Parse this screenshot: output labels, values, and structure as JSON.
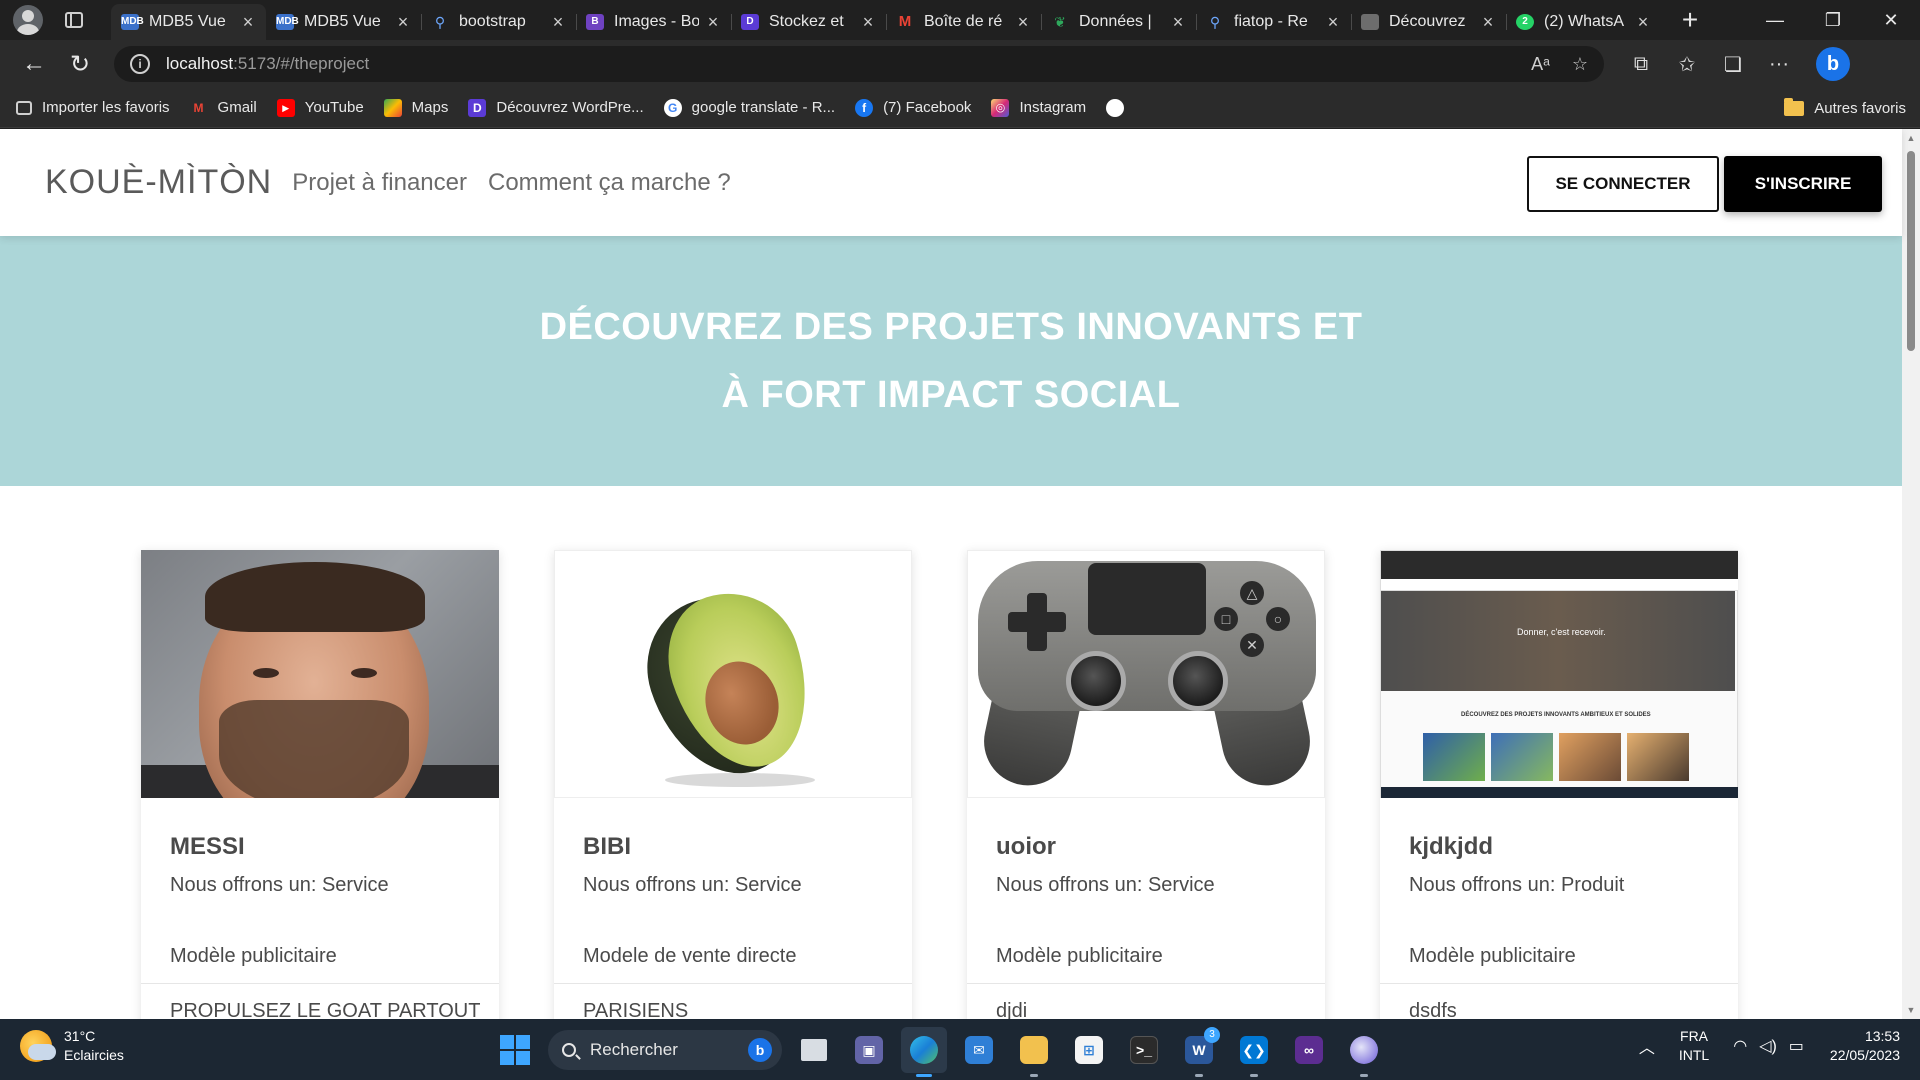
{
  "browser": {
    "tabs": [
      {
        "title": "MDB5 Vue",
        "favicon": "MDB",
        "color": "#3b71ca",
        "active": true
      },
      {
        "title": "MDB5 Vue",
        "favicon": "MDB",
        "color": "#3b71ca",
        "active": false
      },
      {
        "title": "bootstrap",
        "favicon": "search-icon",
        "color": "#3b71ca",
        "active": false
      },
      {
        "title": "Images - Bo",
        "favicon": "B",
        "color": "#6f42c1",
        "active": false
      },
      {
        "title": "Stockez et",
        "favicon": "D",
        "color": "#5b3bd6",
        "active": false
      },
      {
        "title": "Boîte de ré",
        "favicon": "M",
        "color": "#ea4335",
        "active": false
      },
      {
        "title": "Données |",
        "favicon": "leaf",
        "color": "#1e6b3b",
        "active": false
      },
      {
        "title": "fiatop - Re",
        "favicon": "search-icon",
        "color": "#3b71ca",
        "active": false
      },
      {
        "title": "Découvrez",
        "favicon": "page",
        "color": "#6d6d6d",
        "active": false
      },
      {
        "title": "(2) WhatsA",
        "favicon": "2",
        "color": "#25d366",
        "active": false
      }
    ],
    "url_host": "localhost",
    "url_path": ":5173/#/theproject",
    "bookmarks": [
      {
        "label": "Importer les favoris",
        "icon": "import-icon",
        "color": "#5f6368"
      },
      {
        "label": "Gmail",
        "icon": "M",
        "color": "#ea4335"
      },
      {
        "label": "YouTube",
        "icon": "▶",
        "color": "#ff0000"
      },
      {
        "label": "Maps",
        "icon": "maps-icon",
        "color": "#34a853"
      },
      {
        "label": "Découvrez WordPre...",
        "icon": "D",
        "color": "#5b3bd6"
      },
      {
        "label": "google translate - R...",
        "icon": "G",
        "color": "#4285f4"
      },
      {
        "label": "(7) Facebook",
        "icon": "f",
        "color": "#1877f2"
      },
      {
        "label": "Instagram",
        "icon": "◎",
        "color": "#e1306c"
      },
      {
        "label": "",
        "icon": "github-icon",
        "color": "#ffffff"
      }
    ],
    "other_favorites": "Autres favoris"
  },
  "site": {
    "brand": "KOUÈ-MÌTÒN",
    "nav": {
      "projects": "Projet à financer",
      "how": "Comment ça marche ?"
    },
    "login": "SE CONNECTER",
    "signup": "S'INSCRIRE",
    "hero_line1": "DÉCOUVREZ DES PROJETS INNOVANTS ET",
    "hero_line2": "À FORT IMPACT SOCIAL",
    "accent": "#acd6d8",
    "cards": [
      {
        "title": "MESSI",
        "offer": "Nous offrons un: Service",
        "model": "Modèle publicitaire",
        "slogan": "PROPULSEZ LE GOAT PARTOUT",
        "image": "portrait"
      },
      {
        "title": "BIBI",
        "offer": "Nous offrons un: Service",
        "model": "Modele de vente directe",
        "slogan": "PARISIENS",
        "image": "avocado"
      },
      {
        "title": "uoior",
        "offer": "Nous offrons un: Service",
        "model": "Modèle publicitaire",
        "slogan": "djdi",
        "image": "gamepad"
      },
      {
        "title": "kjdkjdd",
        "offer": "Nous offrons un: Produit",
        "model": "Modèle publicitaire",
        "slogan": "dsdfs",
        "image": "screenshot"
      }
    ],
    "screenshot_thumb": {
      "hero_text": "Donner, c'est recevoir.",
      "heading": "DÉCOUVREZ DES PROJETS INNOVANTS AMBITIEUX ET SOLIDES"
    }
  },
  "taskbar": {
    "temperature": "31°C",
    "weather": "Eclaircies",
    "search": "Rechercher",
    "lang_1": "FRA",
    "lang_2": "INTL",
    "time": "13:53",
    "date": "22/05/2023",
    "mail_badge": "3"
  }
}
